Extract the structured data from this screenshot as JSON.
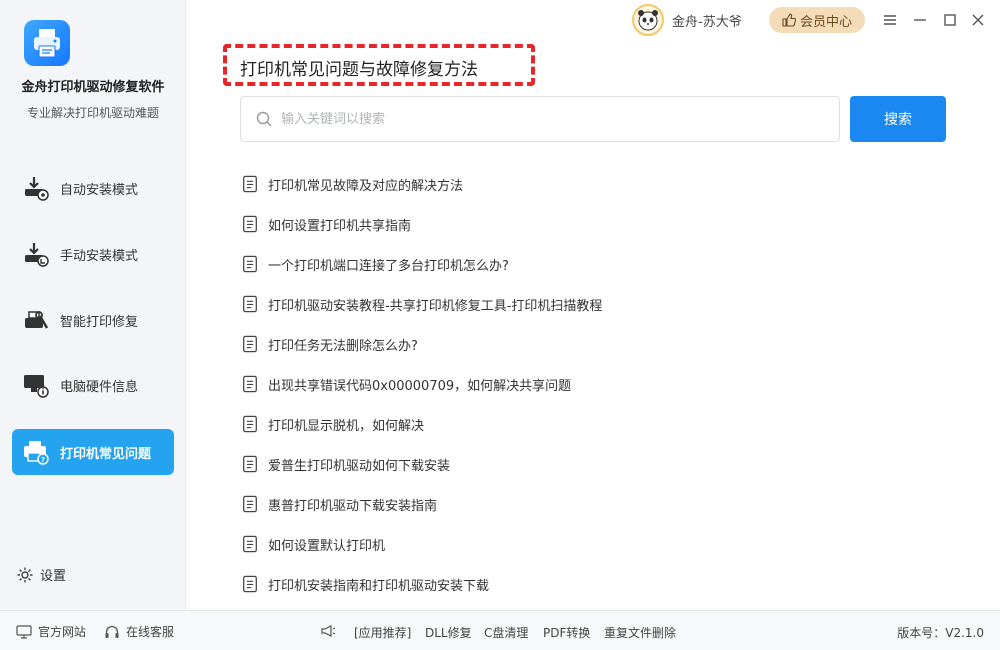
{
  "app": {
    "name": "金舟打印机驱动修复软件",
    "subtitle": "专业解决打印机驱动难题"
  },
  "sidebar": {
    "items": [
      {
        "label": "自动安装模式",
        "icon": "auto-install-icon"
      },
      {
        "label": "手动安装模式",
        "icon": "manual-install-icon"
      },
      {
        "label": "智能打印修复",
        "icon": "repair-tools-icon"
      },
      {
        "label": "电脑硬件信息",
        "icon": "monitor-info-icon"
      },
      {
        "label": "打印机常见问题",
        "icon": "printer-help-icon",
        "active": true
      }
    ],
    "settings_label": "设置"
  },
  "topbar": {
    "username": "金舟-苏大爷",
    "vip_label": "会员中心"
  },
  "main": {
    "title": "打印机常见问题与故障修复方法",
    "search_placeholder": "输入关键词以搜索",
    "search_button": "搜索",
    "faq": [
      "打印机常见故障及对应的解决方法",
      "如何设置打印机共享指南",
      "一个打印机端口连接了多台打印机怎么办?",
      "打印机驱动安装教程-共享打印机修复工具-打印机扫描教程",
      "打印任务无法删除怎么办?",
      "出现共享错误代码0x00000709，如何解决共享问题",
      "打印机显示脱机，如何解决",
      "爱普生打印机驱动如何下载安装",
      "惠普打印机驱动下载安装指南",
      "如何设置默认打印机",
      "打印机安装指南和打印机驱动安装下载"
    ]
  },
  "footer": {
    "website": "官方网站",
    "service": "在线客服",
    "recommend": "[应用推荐]",
    "links": [
      "DLL修复",
      "C盘清理",
      "PDF转换",
      "重复文件删除"
    ],
    "version": "版本号：V2.1.0"
  },
  "colors": {
    "accent": "#1b88f2",
    "active_nav": "#24a3f0",
    "highlight_frame": "#e8262a",
    "vip_bg": "#f5dcb8"
  }
}
